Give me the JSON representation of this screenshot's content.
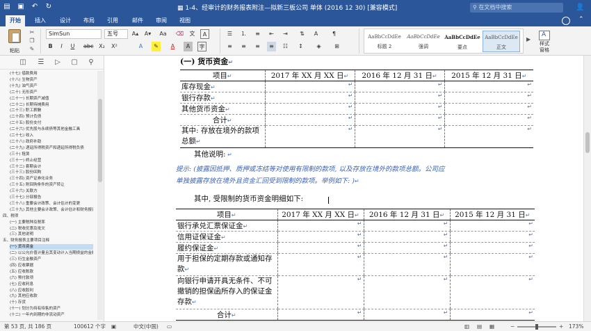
{
  "window": {
    "title": "1-4、经审计的财务报表附注—拟新三板公司 单体 (2016 12 30) [兼容模式]",
    "search_placeholder": "在文档中搜索"
  },
  "ribbon_tabs": [
    "开始",
    "插入",
    "设计",
    "布局",
    "引用",
    "邮件",
    "审阅",
    "视图"
  ],
  "home": {
    "paste_label": "粘贴",
    "font_name": "SimSun",
    "font_size": "五号",
    "styles": [
      {
        "preview": "AaBbCcDdEe",
        "name": "标题 2"
      },
      {
        "preview": "AaBbCcDdEe",
        "name": "强调"
      },
      {
        "preview": "AaBbCcDdEe",
        "name": "要点"
      },
      {
        "preview": "AaBbCcDdEe",
        "name": "正文"
      }
    ],
    "styles_pane_label": "样式\n窗格"
  },
  "nav": {
    "items": [
      "(十七) 借款费用",
      "(十八) 生物资产",
      "(十九) 油气资产",
      "(二十) 无形资产",
      "(二十一) 长期资产减值",
      "(二十二) 长期待摊费用",
      "(二十三) 职工薪酬",
      "(二十四) 预计负债",
      "(二十五) 股份支付",
      "(二十六) 优先股与永续债等其他金融工具",
      "(二十七) 收入",
      "(二十八) 政府补助",
      "(二十九) 递延所得税资产和递延所得税负债",
      "(三十) 租赁",
      "(三十一) 终止经营",
      "(三十二) 套期会计",
      "(三十三) 股份回购",
      "(三十四) 资产证券化业务",
      "(三十五) 附回购条件的资产转让",
      "(三十六) 关联方",
      "(三十七) 分部报告",
      "(三十八) 重要会计政策、会计估计的变更",
      "(三十九) 其他主要会计政策、会计估计和财务报表编制方法",
      "四、税项",
      "(一) 主要税种及税率",
      "(二) 税收优惠及批文",
      "(三) 其他说明",
      "五、财务报表主要项目注释",
      "(一) 货币资金",
      "(二) 以公允价值计量且其变动计入当期损益的金融资产",
      "(三) 衍生金融资产",
      "(四) 应收票据",
      "(五) 应收账款",
      "(六) 预付款项",
      "(七) 应收利息",
      "(八) 应收股利",
      "(九) 其他应收款",
      "(十) 存货",
      "(十一) 划分为持有待售的资产",
      "(十二) 一年内到期的非流动资产"
    ]
  },
  "doc": {
    "section_heading": "(一) 货币资金",
    "table1": {
      "headers": [
        "项目",
        "2017 年 XX 月 XX 日",
        "2016 年 12 月 31 日",
        "2015 年 12 月 31 日"
      ],
      "rows": [
        "库存现金",
        "银行存款",
        "其他货币资金",
        "合计",
        "其中: 存放在境外的款项总额"
      ]
    },
    "other_note": "其他说明:",
    "hint_line1": "提示: (披露因抵押、质押或冻结等对使用有限制的款项, 以及存放在境外的款项总额。公司应",
    "hint_line2": "单独披露存放在境外且资金汇回受到限制的款项。举例如下: )",
    "restricted_intro": "其中, 受限制的货币资金明细如下:",
    "table2": {
      "headers": [
        "项目",
        "2017 年 XX 月 XX 日",
        "2016 年 12 月 31 日",
        "2015 年 12 月 31 日"
      ],
      "rows": [
        "银行承兑汇票保证金",
        "信用证保证金",
        "履约保证金",
        "用于担保的定期存款或通知存款",
        "向银行申请开具无条件、不可撤销的担保函所存入的保证金存款",
        "合计"
      ]
    }
  },
  "status": {
    "page": "第 53 页, 共 186 页",
    "words": "100612 个字",
    "language": "中文(中国)",
    "zoom": "173%"
  }
}
